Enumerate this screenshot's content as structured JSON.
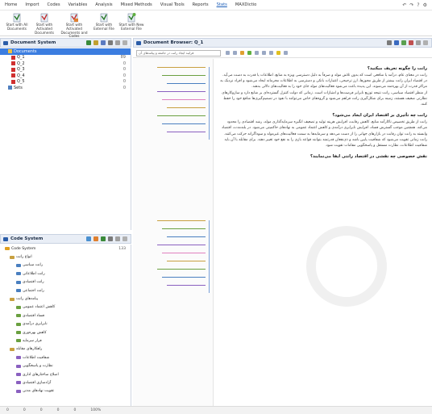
{
  "menubar": {
    "items": [
      "Home",
      "Import",
      "Codes",
      "Variables",
      "Analysis",
      "Mixed Methods",
      "Visual Tools",
      "Reports",
      "Stats",
      "MAXDictio"
    ],
    "active_index": 8
  },
  "ribbon": {
    "buttons": [
      {
        "label": "Start with All Documents",
        "icon": "stats-all-icon",
        "color": "#2a7a2a"
      },
      {
        "label": "Start with Activated Documents",
        "icon": "stats-activated-docs-icon",
        "color": "#c03030"
      },
      {
        "label": "Start with Activated Documents and Codes",
        "icon": "stats-activated-codes-icon",
        "color": "#c03030"
      },
      {
        "label": "Start with External File",
        "icon": "external-file-icon",
        "color": "#2a7a2a"
      },
      {
        "label": "Start with New External File",
        "icon": "new-external-file-icon",
        "color": "#2a7a2a"
      }
    ]
  },
  "document_system": {
    "title": "Document System",
    "root_label": "Documents",
    "documents": [
      {
        "label": "Q_1",
        "count": "89"
      },
      {
        "label": "Q_2",
        "count": "0"
      },
      {
        "label": "Q_3",
        "count": "0"
      },
      {
        "label": "Q_4",
        "count": "0"
      },
      {
        "label": "Q_5",
        "count": "0"
      }
    ],
    "sets_label": "Sets",
    "sets_count": "0"
  },
  "code_system": {
    "title": "Code System",
    "root_label": "Code System",
    "root_count": "133",
    "items": [
      {
        "label": "انواع رانت",
        "count": "",
        "color": "#c8a040"
      },
      {
        "label": "رانت سیاسی",
        "count": "",
        "color": "#4a7fc0"
      },
      {
        "label": "رانت اطلاعاتی",
        "count": "",
        "color": "#4a7fc0"
      },
      {
        "label": "رانت اقتصادی",
        "count": "",
        "color": "#4a7fc0"
      },
      {
        "label": "رانت اجتماعی",
        "count": "",
        "color": "#4a7fc0"
      },
      {
        "label": "پیامدهای رانت",
        "count": "",
        "color": "#c8a040"
      },
      {
        "label": "کاهش اعتماد عمومی",
        "count": "",
        "color": "#6aa040"
      },
      {
        "label": "فساد اقتصادی",
        "count": "",
        "color": "#6aa040"
      },
      {
        "label": "نابرابری درآمدی",
        "count": "",
        "color": "#6aa040"
      },
      {
        "label": "کاهش بهره‌وری",
        "count": "",
        "color": "#6aa040"
      },
      {
        "label": "فرار سرمایه",
        "count": "",
        "color": "#6aa040"
      },
      {
        "label": "راهکارهای مقابله",
        "count": "",
        "color": "#c8a040"
      },
      {
        "label": "شفافیت اطلاعات",
        "count": "",
        "color": "#8a60c0"
      },
      {
        "label": "نظارت و پاسخگویی",
        "count": "",
        "color": "#8a60c0"
      },
      {
        "label": "اصلاح ساختارهای اداری",
        "count": "",
        "color": "#8a60c0"
      },
      {
        "label": "آزادسازی اقتصادی",
        "count": "",
        "color": "#8a60c0"
      },
      {
        "label": "تقویت نهادهای مدنی",
        "count": "",
        "color": "#8a60c0"
      }
    ]
  },
  "document_browser": {
    "title": "Document Browser: Q_1",
    "doc_select_value": "فرایند ایجاد رانت در جامعه و پیامدهای آن"
  },
  "document_text": [
    {
      "q": "رانت را چگونه تعریف میکنید؟",
      "p": "رانت در معنای عام، درآمد یا منافعی است که بدون تلاش مولد و صرفاً به دلیل دسترسی ویژه به منابع، اطلاعات یا قدرت به دست می‌آید. در اقتصاد ایران رانت بیشتر از طریق مجوزها، ارز ترجیحی، اعتبارات بانکی و دسترسی به اطلاعات محرمانه ایجاد می‌شود و افراد نزدیک به مراکز قدرت از آن بهره‌مند می‌شوند. این پدیده باعث می‌شود فعالیت‌های مولد جای خود را به فعالیت‌های دلالی بدهند."
    },
    {
      "q": "",
      "p": "از منظر اقتصاد سیاسی، رانت نتیجه توزیع نابرابر فرصت‌ها و امتیازات است. زمانی که دولت کنترل گسترده‌ای بر منابع دارد و سازوکارهای نظارتی ضعیف هستند، زمینه برای شکل‌گیری رانت فراهم می‌شود و گروه‌های خاص می‌توانند با نفوذ در تصمیم‌گیری‌ها منافع خود را حفظ کنند."
    },
    {
      "q": "رانت چه تأثیری بر اقتصاد ایران ایجاد می‌شود؟",
      "p": "رانت از طریق تخصیص ناکارآمد منابع، کاهش رقابت، افزایش هزینه تولید و تضعیف انگیزه سرمایه‌گذاری مولد، رشد اقتصادی را محدود می‌کند. همچنین موجب گسترش فساد، افزایش نابرابری درآمدی و کاهش اعتماد عمومی به نهادهای حاکمیتی می‌شود. در بلندمدت، اقتصاد وابسته به رانت توان رقابت در بازارهای جهانی را از دست می‌دهد و سرمایه‌ها به سمت فعالیت‌های غیرمولد و سوداگرانه حرکت می‌کنند."
    },
    {
      "q": "",
      "p": "رانت زمانی تقویت می‌شود که شفافیت پایین باشد و ذی‌نفعان قدرتمند بتوانند قواعد بازی را به نفع خود تغییر دهند. برای مقابله با آن باید شفافیت اطلاعات، نظارت مستقل و پاسخگویی مقامات تقویت شود."
    },
    {
      "q": "نقش خصوصی چه نقشی در اقتصاد رانتی ایفا می‌نمایند؟",
      "p": ""
    }
  ],
  "status": {
    "items": [
      "0",
      "0",
      "0",
      "0",
      "0"
    ],
    "zoom": "100%"
  }
}
